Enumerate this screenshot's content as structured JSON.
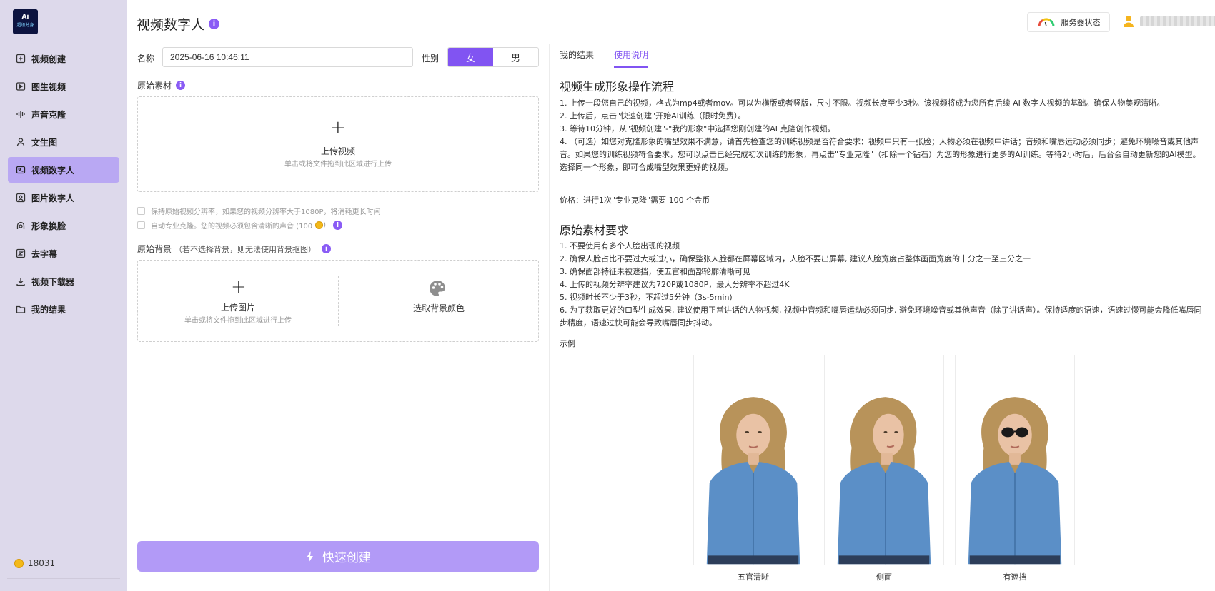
{
  "logo": {
    "line1": "Ai",
    "line2": "超级分身"
  },
  "sidebar": {
    "items": [
      {
        "label": "视频创建",
        "icon": "plus-square-icon"
      },
      {
        "label": "图生视频",
        "icon": "image-play-icon"
      },
      {
        "label": "声音克隆",
        "icon": "audio-wave-icon"
      },
      {
        "label": "文生图",
        "icon": "user-icon"
      },
      {
        "label": "视频数字人",
        "icon": "video-person-icon",
        "active": true
      },
      {
        "label": "图片数字人",
        "icon": "image-person-icon"
      },
      {
        "label": "形象换脸",
        "icon": "face-swap-icon"
      },
      {
        "label": "去字幕",
        "icon": "subtitle-icon"
      },
      {
        "label": "视频下载器",
        "icon": "download-icon"
      },
      {
        "label": "我的结果",
        "icon": "folder-icon"
      }
    ],
    "coins": "18031"
  },
  "header": {
    "title": "视频数字人",
    "info": "i",
    "server_status": "服务器状态"
  },
  "form": {
    "name_label": "名称",
    "name_value": "2025-06-16 10:46:11",
    "gender_label": "性别",
    "gender_female": "女",
    "gender_male": "男",
    "source_label": "原始素材",
    "upload_video_title": "上传视频",
    "upload_video_hint": "单击或将文件拖到此区域进行上传",
    "keep_resolution": "保持原始视频分辨率，如果您的视频分辨率大于1080P，将消耗更长时间",
    "auto_pro_clone": "自动专业克隆。您的视频必须包含清晰的声音 (100",
    "bg_label": "原始背景",
    "bg_note": "（若不选择背景，则无法使用背景抠图）",
    "upload_image_title": "上传图片",
    "upload_image_hint": "单击或将文件拖到此区域进行上传",
    "pick_color": "选取背景颜色",
    "create_button": "快速创建"
  },
  "tabs": [
    {
      "label": "我的结果"
    },
    {
      "label": "使用说明",
      "active": true
    }
  ],
  "guide": {
    "title1": "视频生成形象操作流程",
    "steps": [
      "1. 上传一段您自己的视频，格式为mp4或者mov。可以为横版或者竖版，尺寸不限。视频长度至少3秒。该视频将成为您所有后续 AI 数字人视频的基础。确保人物美观清晰。",
      "2. 上传后，点击\"快速创建\"开始AI训练（限时免费）。",
      "3. 等待10分钟，从\"视频创建\"-\"我的形象\"中选择您刚创建的AI 克隆创作视频。",
      "4. （可选）如您对克隆形象的嘴型效果不满意，请首先检查您的训练视频是否符合要求：视频中只有一张脸；人物必须在视频中讲话；音频和嘴唇运动必须同步；避免环境噪音或其他声音。如果您的训练视频符合要求，您可以点击已经完成初次训练的形象，再点击\"专业克隆\"（扣除一个钻石）为您的形象进行更多的AI训练。等待2小时后，后台会自动更新您的AI模型。选择同一个形象，即可合成嘴型效果更好的视频。"
    ],
    "price": "价格：进行1次\"专业克隆\"需要 100 个金币",
    "title2": "原始素材要求",
    "requirements": [
      "1. 不要使用有多个人脸出现的视频",
      "2. 确保人脸占比不要过大或过小，确保整张人脸都在屏幕区域内，人脸不要出屏幕, 建议人脸宽度占整体画面宽度的十分之一至三分之一",
      "3. 确保面部特征未被遮挡，使五官和面部轮廓清晰可见",
      "4. 上传的视频分辨率建议为720P或1080P，最大分辨率不超过4K",
      "5. 视频时长不少于3秒，不超过5分钟（3s-5min)",
      "6. 为了获取更好的口型生成效果, 建议使用正常讲话的人物视频, 视频中音频和嘴唇运动必须同步, 避免环境噪音或其他声音（除了讲话声）。保持适度的语速，语速过慢可能会降低嘴唇同步精度，语速过快可能会导致嘴唇同步抖动。"
    ],
    "sample_label": "示例",
    "samples": [
      {
        "caption": "五官清晰"
      },
      {
        "caption": "侧面"
      },
      {
        "caption": "有遮挡"
      }
    ]
  },
  "colors": {
    "accent": "#8154f2",
    "sidebar_bg": "#ddd9eb",
    "active_nav": "#b9a8f3",
    "button_disabled": "#b29af7"
  }
}
